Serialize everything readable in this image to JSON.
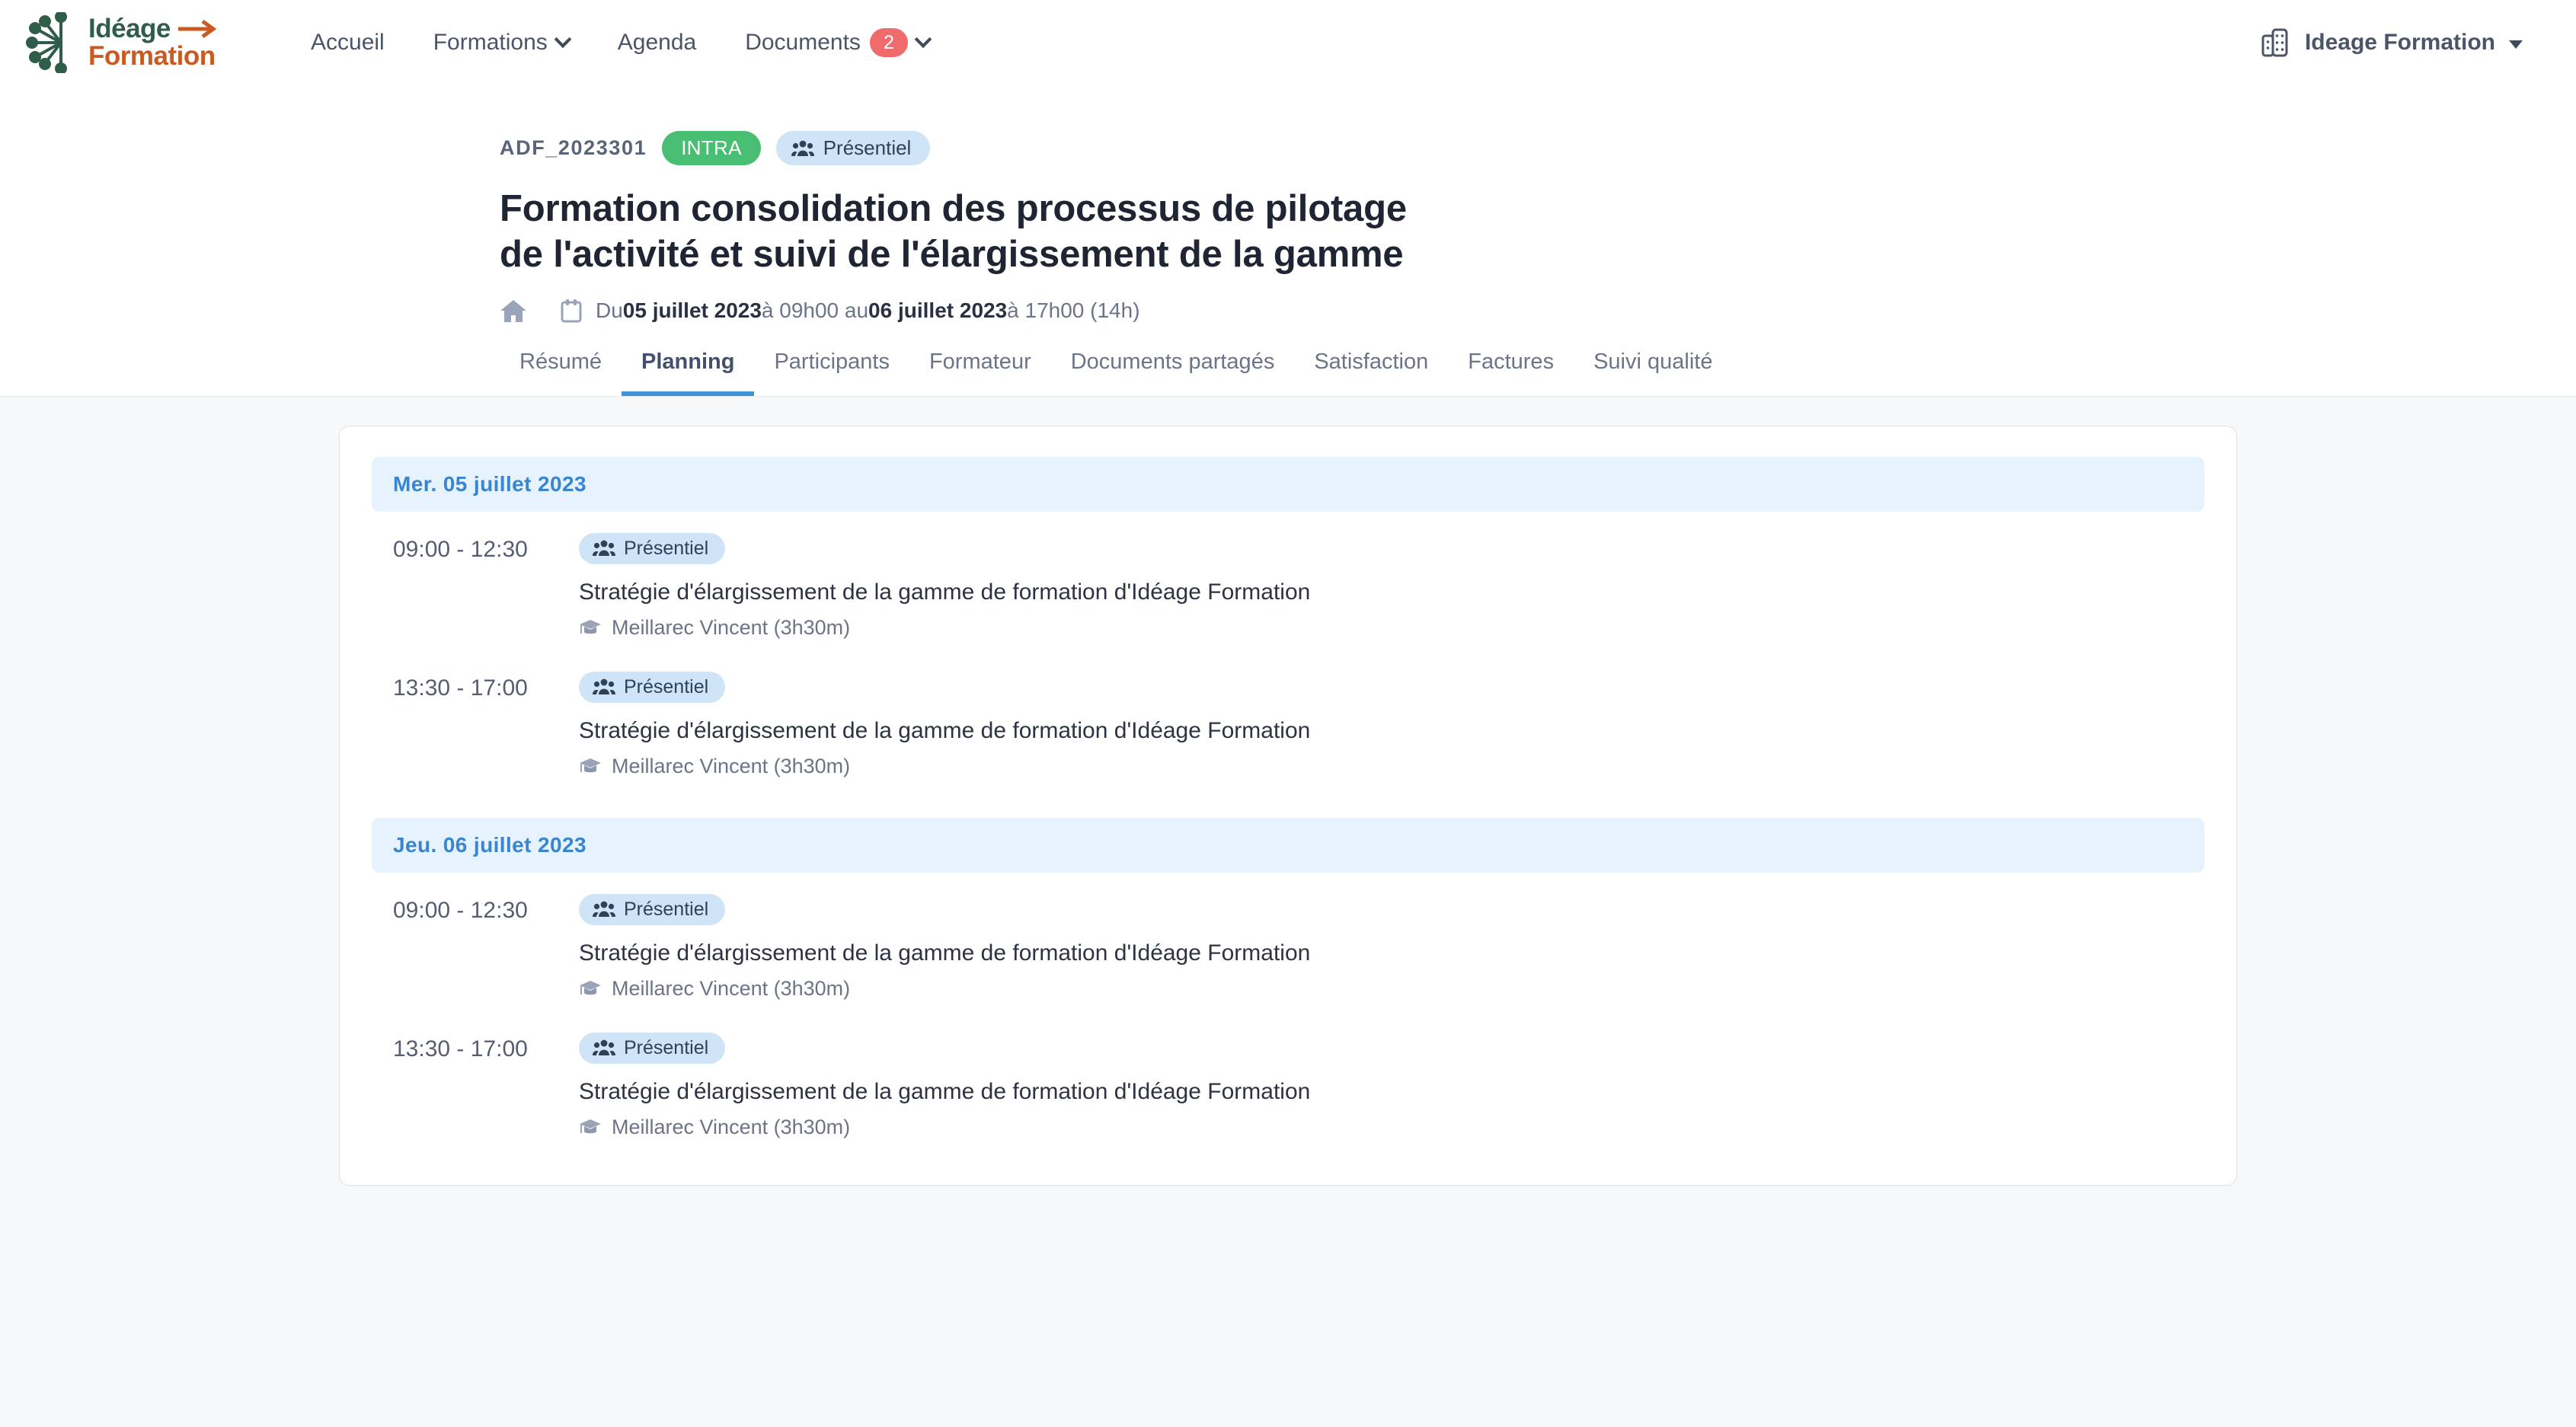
{
  "brand": {
    "line1": "Idéage",
    "line2": "Formation",
    "mark_icon": "ideage-logo-icon",
    "arrow_icon": "arrow-right-icon"
  },
  "nav": {
    "items": [
      {
        "label": "Accueil",
        "icon": null,
        "badge": null,
        "caret": false
      },
      {
        "label": "Formations",
        "icon": null,
        "badge": null,
        "caret": true
      },
      {
        "label": "Agenda",
        "icon": null,
        "badge": null,
        "caret": false
      },
      {
        "label": "Documents",
        "icon": null,
        "badge": "2",
        "caret": true
      }
    ],
    "account": {
      "label": "Ideage Formation",
      "icon": "building-icon",
      "caret_icon": "caret-down-icon"
    }
  },
  "header": {
    "ref": "ADF_2023301",
    "tag_intra": "INTRA",
    "tag_mode": "Présentiel",
    "tag_mode_icon": "users-icon",
    "title": "Formation consolidation des processus de pilotage de l'activité et suivi de l'élargissement de la gamme",
    "home_icon": "home-icon",
    "calendar_icon": "calendar-icon",
    "date": {
      "prefix": "Du ",
      "start_date": "05 juillet 2023",
      "mid1": " à 09h00 au ",
      "end_date": "06 juillet 2023",
      "mid2": " à 17h00 (14h)"
    }
  },
  "tabs": [
    {
      "label": "Résumé",
      "active": false
    },
    {
      "label": "Planning",
      "active": true
    },
    {
      "label": "Participants",
      "active": false
    },
    {
      "label": "Formateur",
      "active": false
    },
    {
      "label": "Documents partagés",
      "active": false
    },
    {
      "label": "Satisfaction",
      "active": false
    },
    {
      "label": "Factures",
      "active": false
    },
    {
      "label": "Suivi qualité",
      "active": false
    }
  ],
  "planning": {
    "days": [
      {
        "day_label": "Mer. 05 juillet 2023",
        "sessions": [
          {
            "time": "09:00 - 12:30",
            "mode": "Présentiel",
            "mode_icon": "users-icon",
            "title": "Stratégie d'élargissement de la gamme de formation d'Idéage Formation",
            "trainer": "Meillarec Vincent (3h30m)",
            "trainer_icon": "graduation-cap-icon"
          },
          {
            "time": "13:30 - 17:00",
            "mode": "Présentiel",
            "mode_icon": "users-icon",
            "title": "Stratégie d'élargissement de la gamme de formation d'Idéage Formation",
            "trainer": "Meillarec Vincent (3h30m)",
            "trainer_icon": "graduation-cap-icon"
          }
        ]
      },
      {
        "day_label": "Jeu. 06 juillet 2023",
        "sessions": [
          {
            "time": "09:00 - 12:30",
            "mode": "Présentiel",
            "mode_icon": "users-icon",
            "title": "Stratégie d'élargissement de la gamme de formation d'Idéage Formation",
            "trainer": "Meillarec Vincent (3h30m)",
            "trainer_icon": "graduation-cap-icon"
          },
          {
            "time": "13:30 - 17:00",
            "mode": "Présentiel",
            "mode_icon": "users-icon",
            "title": "Stratégie d'élargissement de la gamme de formation d'Idéage Formation",
            "trainer": "Meillarec Vincent (3h30m)",
            "trainer_icon": "graduation-cap-icon"
          }
        ]
      }
    ]
  },
  "colors": {
    "page_bg": "#f7f8fa",
    "accent_blue": "#3e93d6",
    "day_bg": "#e6f2fd",
    "day_text": "#3a86ce",
    "pill_blue_bg": "#cfe5f7",
    "green": "#49bf74",
    "badge_red": "#f06b6b",
    "brand_green": "#2f5d4a",
    "brand_orange": "#c85a22"
  }
}
